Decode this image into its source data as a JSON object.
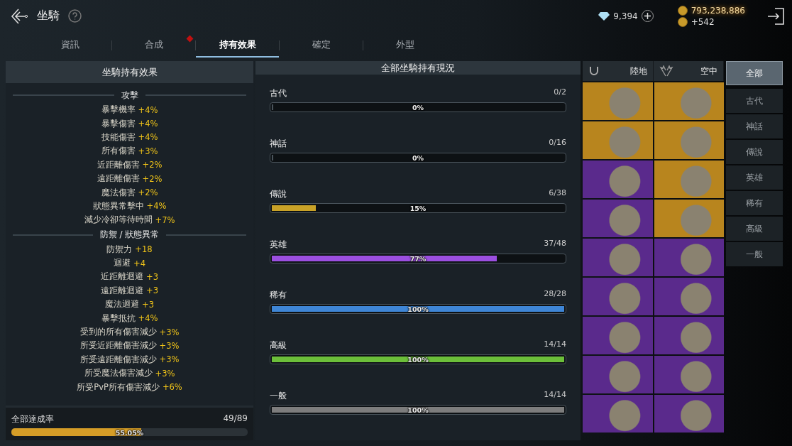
{
  "header": {
    "title": "坐騎",
    "gems": "9,394",
    "gold": "793,238,886",
    "gold_gain": "+542"
  },
  "tabs": [
    {
      "label": "資訊",
      "selected": false,
      "alert": false
    },
    {
      "label": "合成",
      "selected": false,
      "alert": true
    },
    {
      "label": "持有效果",
      "selected": true,
      "alert": false
    },
    {
      "label": "確定",
      "selected": false,
      "alert": false
    },
    {
      "label": "外型",
      "selected": false,
      "alert": false
    }
  ],
  "effects_panel": {
    "title": "坐騎持有效果",
    "sections": [
      {
        "heading": "攻擊",
        "stats": [
          {
            "name": "暴擊機率",
            "value": "+4%"
          },
          {
            "name": "暴擊傷害",
            "value": "+4%"
          },
          {
            "name": "技能傷害",
            "value": "+4%"
          },
          {
            "name": "所有傷害",
            "value": "+3%"
          },
          {
            "name": "近距離傷害",
            "value": "+2%"
          },
          {
            "name": "遠距離傷害",
            "value": "+2%"
          },
          {
            "name": "魔法傷害",
            "value": "+2%"
          },
          {
            "name": "狀態異常擊中",
            "value": "+4%"
          },
          {
            "name": "減少冷卻等待時間",
            "value": "+7%"
          }
        ]
      },
      {
        "heading": "防禦 / 狀態異常",
        "stats": [
          {
            "name": "防禦力",
            "value": "+18"
          },
          {
            "name": "迴避",
            "value": "+4"
          },
          {
            "name": "近距離迴避",
            "value": "+3"
          },
          {
            "name": "遠距離迴避",
            "value": "+3"
          },
          {
            "name": "魔法迴避",
            "value": "+3"
          },
          {
            "name": "暴擊抵抗",
            "value": "+4%"
          },
          {
            "name": "受到的所有傷害減少",
            "value": "+3%"
          },
          {
            "name": "所受近距離傷害減少",
            "value": "+3%"
          },
          {
            "name": "所受遠距離傷害減少",
            "value": "+3%"
          },
          {
            "name": "所受魔法傷害減少",
            "value": "+3%"
          },
          {
            "name": "所受PvP所有傷害減少",
            "value": "+6%"
          }
        ]
      }
    ],
    "total": {
      "label": "全部達成率",
      "count": "49/89",
      "percent": "55.05%",
      "level": 0.5505
    }
  },
  "status_panel": {
    "title": "全部坐騎持有現況",
    "grades": [
      {
        "name": "古代",
        "count": "0/2",
        "percent": "0%",
        "level": 0
      },
      {
        "name": "神話",
        "count": "0/16",
        "percent": "0%",
        "level": 0
      },
      {
        "name": "傳說",
        "count": "6/38",
        "percent": "15%",
        "level": 0.15,
        "color": "#c9a227"
      },
      {
        "name": "英雄",
        "count": "37/48",
        "percent": "77%",
        "level": 0.77,
        "color": "#9b4fe0"
      },
      {
        "name": "稀有",
        "count": "28/28",
        "percent": "100%",
        "level": 1,
        "color": "#3f86d6"
      },
      {
        "name": "高級",
        "count": "14/14",
        "percent": "100%",
        "level": 1,
        "color": "#6cbf3a"
      },
      {
        "name": "一般",
        "count": "14/14",
        "percent": "100%",
        "level": 1,
        "color": "#7d7d7d"
      }
    ]
  },
  "mount_types": [
    {
      "label": "陸地",
      "kind": "land"
    },
    {
      "label": "空中",
      "kind": "air"
    }
  ],
  "mounts": [
    {
      "color": "#b8851e"
    },
    {
      "color": "#b8851e"
    },
    {
      "color": "#b8851e"
    },
    {
      "color": "#b8851e"
    },
    {
      "color": "#5a2a8c"
    },
    {
      "color": "#b8851e"
    },
    {
      "color": "#5a2a8c"
    },
    {
      "color": "#b8851e"
    },
    {
      "color": "#5a2a8c"
    },
    {
      "color": "#5a2a8c"
    },
    {
      "color": "#5a2a8c"
    },
    {
      "color": "#5a2a8c"
    },
    {
      "color": "#5a2a8c"
    },
    {
      "color": "#5a2a8c"
    },
    {
      "color": "#5a2a8c"
    },
    {
      "color": "#5a2a8c"
    },
    {
      "color": "#5a2a8c"
    },
    {
      "color": "#5a2a8c"
    }
  ],
  "filters": [
    {
      "label": "全部",
      "selected": true
    },
    {
      "label": "古代",
      "selected": false
    },
    {
      "label": "神話",
      "selected": false
    },
    {
      "label": "傳說",
      "selected": false
    },
    {
      "label": "英雄",
      "selected": false
    },
    {
      "label": "稀有",
      "selected": false
    },
    {
      "label": "高級",
      "selected": false
    },
    {
      "label": "一般",
      "selected": false
    }
  ]
}
